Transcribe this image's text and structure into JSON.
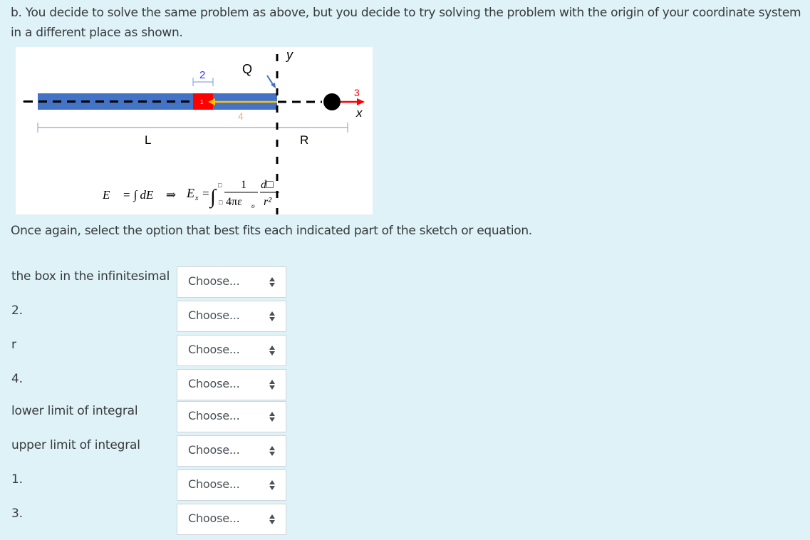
{
  "question": {
    "intro": "b. You decide to solve the same problem as above, but you decide to try solving the problem with the origin of your coordinate system in a different place as shown.",
    "instruction": "Once again, select the option that best fits each indicated part of the sketch or equation."
  },
  "figure": {
    "labels": {
      "y_axis": "y",
      "x_axis": "x",
      "charge": "Q",
      "length": "L",
      "distance": "R",
      "marker_1": "1",
      "marker_2": "2",
      "marker_3": "3",
      "marker_4": "4"
    },
    "equation": {
      "left": "E⃗ = ∫ dE⃗ ⇒",
      "lhs": "E",
      "lhs_sub": "x",
      "equals": "=",
      "integral": "∫",
      "numerator": "1",
      "denominator": "4πε",
      "denominator_sub": "o",
      "diff_num": "d□",
      "diff_den": "r²",
      "limit_upper": "□",
      "limit_lower": "□"
    },
    "colors": {
      "rod": "#4472c4",
      "element": "#ff0000",
      "arrow_r": "#ffc000",
      "arrow_field": "#ff0000",
      "label_2": "#3333ff",
      "label_3": "#ff0000",
      "label_4": "#f4b183",
      "dimension": "#8ea9db"
    }
  },
  "rows": [
    {
      "label": "the box in the infinitesimal",
      "value": "Choose..."
    },
    {
      "label": "2.",
      "value": "Choose..."
    },
    {
      "label": "r",
      "value": "Choose..."
    },
    {
      "label": "4.",
      "value": "Choose..."
    },
    {
      "label": "lower limit of integral",
      "value": "Choose..."
    },
    {
      "label": "upper limit of integral",
      "value": "Choose..."
    },
    {
      "label": "1.",
      "value": "Choose..."
    },
    {
      "label": "3.",
      "value": "Choose..."
    }
  ]
}
